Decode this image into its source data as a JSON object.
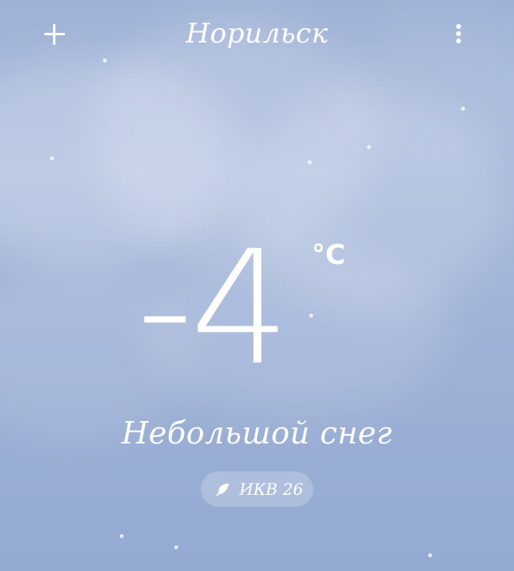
{
  "header": {
    "city": "Норильск",
    "add_icon": "plus-icon",
    "more_icon": "vertical-dots-icon"
  },
  "weather": {
    "temperature": "-4",
    "unit": "°C",
    "condition": "Небольшой снег"
  },
  "air_quality": {
    "label": "ИКВ 26",
    "icon": "leaf-icon"
  },
  "colors": {
    "sky_top": "#9fb2d6",
    "sky_bottom": "#94aad3",
    "text": "#ffffff"
  }
}
